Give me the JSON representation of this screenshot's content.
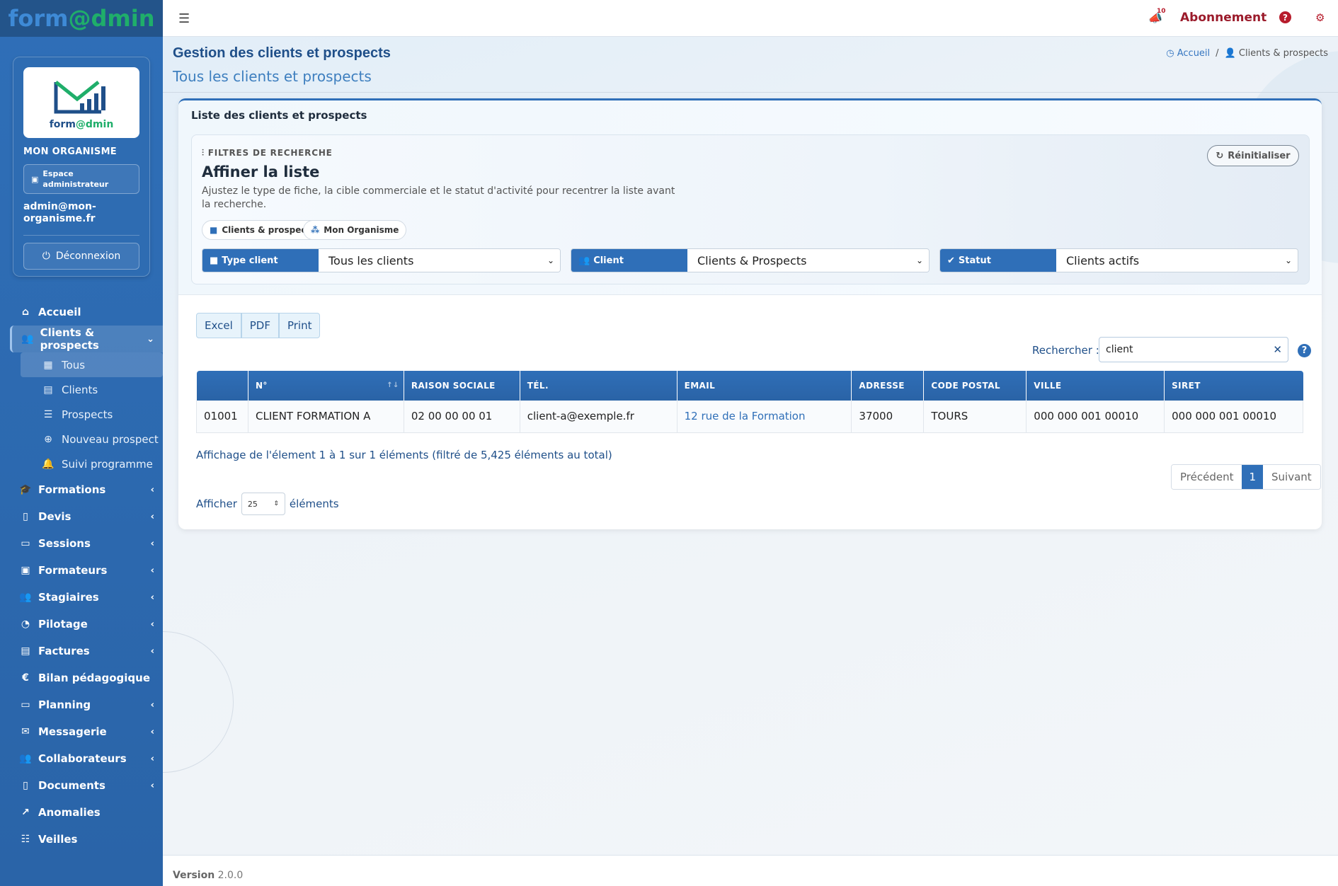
{
  "brand": {
    "part1": "form",
    "part2": "@dmin"
  },
  "profile": {
    "logo_word_a": "form",
    "logo_word_b": "@dmin",
    "org_name": "MON ORGANISME",
    "admin_badge": "Espace administrateur",
    "email": "admin@mon-organisme.fr",
    "logout": "Déconnexion"
  },
  "nav": {
    "accueil": "Accueil",
    "clients": "Clients & prospects",
    "sub": {
      "tous": "Tous",
      "clients": "Clients",
      "prospects": "Prospects",
      "nouveau": "Nouveau prospect",
      "suivi": "Suivi programme"
    },
    "formations": "Formations",
    "devis": "Devis",
    "sessions": "Sessions",
    "formateurs": "Formateurs",
    "stagiaires": "Stagiaires",
    "pilotage": "Pilotage",
    "factures": "Factures",
    "bilan": "Bilan pédagogique",
    "planning": "Planning",
    "messagerie": "Messagerie",
    "collaborateurs": "Collaborateurs",
    "documents": "Documents",
    "anomalies": "Anomalies",
    "veilles": "Veilles"
  },
  "topbar": {
    "notif_count": "10",
    "abonnement": "Abonnement"
  },
  "page": {
    "title": "Gestion des clients et prospects",
    "subtitle": "Tous les clients et prospects",
    "crumb_home": "Accueil",
    "crumb_current": "Clients & prospects"
  },
  "card": {
    "title": "Liste des clients et prospects",
    "filters_label": "FILTRES DE RECHERCHE",
    "filters_title": "Affiner la liste",
    "filters_desc": "Ajustez le type de fiche, la cible commerciale et le statut d'activité pour recentrer la liste avant la recherche.",
    "reset": "Réinitialiser",
    "pill1": "Clients & prospects",
    "pill2": "Mon Organisme",
    "type_label": "Type client",
    "type_value": "Tous les clients",
    "client_label": "Client",
    "client_value": "Clients & Prospects",
    "statut_label": "Statut",
    "statut_value": "Clients actifs"
  },
  "export": {
    "excel": "Excel",
    "pdf": "PDF",
    "print": "Print"
  },
  "search": {
    "label": "Rechercher :",
    "value": "client"
  },
  "table": {
    "headers": [
      "",
      "N°",
      "RAISON SOCIALE",
      "TÉL.",
      "EMAIL",
      "ADRESSE",
      "CODE POSTAL",
      "VILLE",
      "SIRET"
    ],
    "row": [
      "01001",
      "CLIENT FORMATION A",
      "02 00 00 00 01",
      "client-a@exemple.fr",
      "12 rue de la Formation",
      "37000",
      "TOURS",
      "000 000 001 00010",
      "000 000 001 00010"
    ]
  },
  "info": "Affichage de l'élement 1 à 1 sur 1 éléments (filtré de 5,425 éléments au total)",
  "pager": {
    "prev": "Précédent",
    "page": "1",
    "next": "Suivant"
  },
  "length": {
    "before": "Afficher",
    "value": "25",
    "after": "éléments"
  },
  "footer": {
    "version_label": "Version",
    "version": "2.0.0"
  }
}
